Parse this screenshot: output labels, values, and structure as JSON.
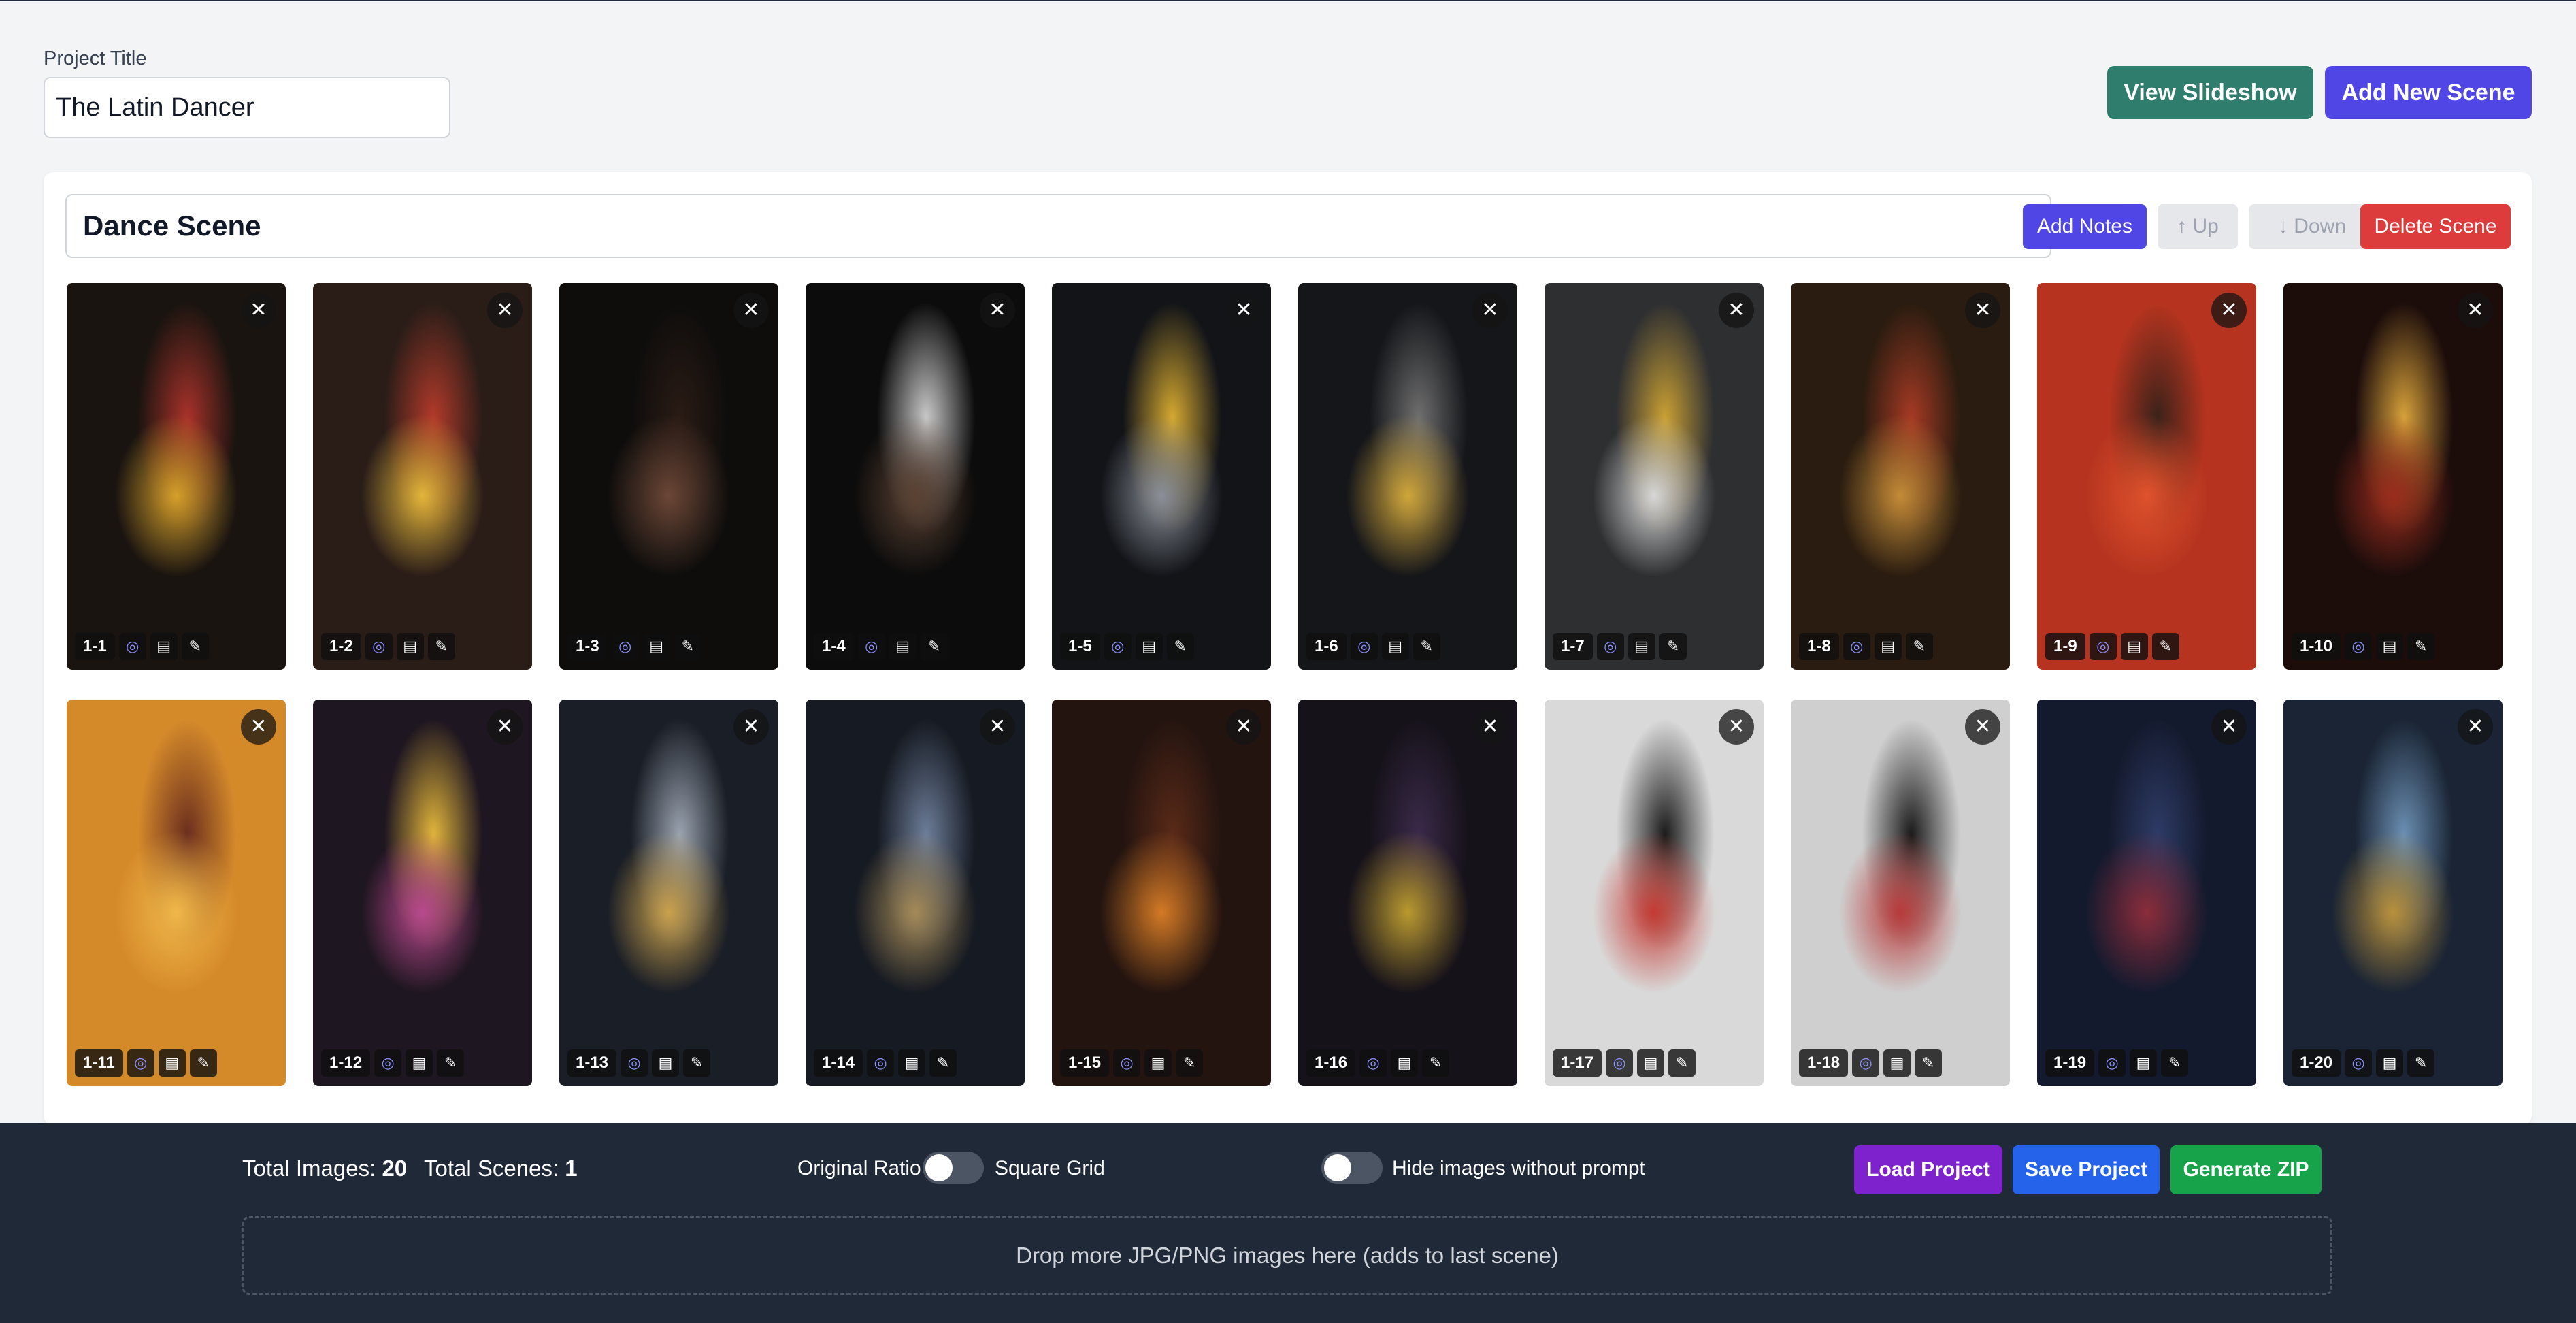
{
  "project": {
    "label": "Project Title",
    "title": "The Latin Dancer"
  },
  "header": {
    "view_slideshow": "View Slideshow",
    "add_new_scene": "Add New Scene"
  },
  "scene": {
    "title": "Dance Scene",
    "add_notes": "Add Notes",
    "up": "↑ Up",
    "down": "↓ Down",
    "delete": "Delete Scene",
    "images": [
      {
        "num": "1-1",
        "palette": [
          "#1a1410",
          "#d5a02a",
          "#a8322a"
        ]
      },
      {
        "num": "1-2",
        "palette": [
          "#2a1d18",
          "#e2b53a",
          "#b23a2a"
        ]
      },
      {
        "num": "1-3",
        "palette": [
          "#0e0d0c",
          "#6b4636",
          "#2a1b15"
        ]
      },
      {
        "num": "1-4",
        "palette": [
          "#0c0c0c",
          "#5b4132",
          "#c9c9c9"
        ]
      },
      {
        "num": "1-5",
        "palette": [
          "#121418",
          "#8a8f99",
          "#d6a92f"
        ]
      },
      {
        "num": "1-6",
        "palette": [
          "#15161a",
          "#d0a63a",
          "#6f6f6f"
        ]
      },
      {
        "num": "1-7",
        "palette": [
          "#2e2f31",
          "#d7d7d7",
          "#caa033"
        ]
      },
      {
        "num": "1-8",
        "palette": [
          "#2a1c10",
          "#c28b37",
          "#a63a24"
        ]
      },
      {
        "num": "1-9",
        "palette": [
          "#b6341f",
          "#e0522c",
          "#3a221a"
        ]
      },
      {
        "num": "1-10",
        "palette": [
          "#1c0d0b",
          "#9b2c1d",
          "#d8a23a"
        ]
      },
      {
        "num": "1-11",
        "palette": [
          "#d58a2a",
          "#f0b84a",
          "#6b2e1e"
        ]
      },
      {
        "num": "1-12",
        "palette": [
          "#1e1620",
          "#b8488d",
          "#e2b53a"
        ]
      },
      {
        "num": "1-13",
        "palette": [
          "#1a1e26",
          "#c9a14d",
          "#9aa3b0"
        ]
      },
      {
        "num": "1-14",
        "palette": [
          "#161a22",
          "#a48a58",
          "#6d7d99"
        ]
      },
      {
        "num": "1-15",
        "palette": [
          "#241410",
          "#d37a25",
          "#5a2a18"
        ]
      },
      {
        "num": "1-16",
        "palette": [
          "#16121a",
          "#b9992f",
          "#3b2a4a"
        ]
      },
      {
        "num": "1-17",
        "palette": [
          "#d9d9d9",
          "#c43a33",
          "#1a1a1a"
        ]
      },
      {
        "num": "1-18",
        "palette": [
          "#cfcfcf",
          "#b83a3a",
          "#1a1a1a"
        ]
      },
      {
        "num": "1-19",
        "palette": [
          "#141a2e",
          "#8a2c3a",
          "#2e3b66"
        ]
      },
      {
        "num": "1-20",
        "palette": [
          "#1a2434",
          "#b8903b",
          "#6b8fb3"
        ]
      }
    ]
  },
  "footer": {
    "total_images_label": "Total Images:",
    "total_images": "20",
    "total_scenes_label": "Total Scenes:",
    "total_scenes": "1",
    "ratio_left": "Original Ratio",
    "ratio_right": "Square Grid",
    "hide_label": "Hide images without prompt",
    "load": "Load Project",
    "save": "Save Project",
    "zip": "Generate ZIP",
    "drop_text": "Drop more JPG/PNG images here (adds to last scene)"
  },
  "icons": {
    "close": "close-icon",
    "check": "check-circle-icon",
    "doc": "document-icon",
    "edit": "edit-icon"
  }
}
